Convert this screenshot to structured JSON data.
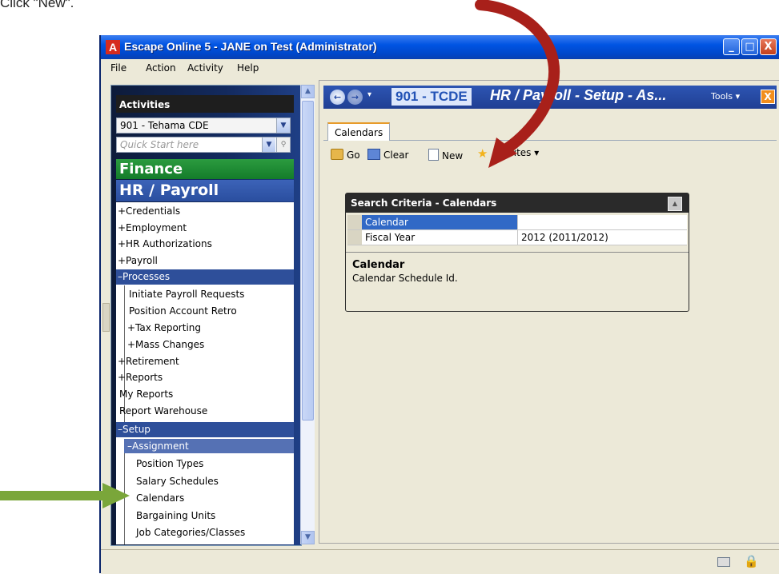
{
  "caption": "Click \"New\".",
  "window": {
    "title": "Escape Online 5 - JANE on Test (Administrator)",
    "app_icon_letter": "A",
    "minimize": "_",
    "maximize": "□",
    "close": "X"
  },
  "menu": [
    {
      "first": "F",
      "rest": "ile"
    },
    {
      "first": "",
      "u": "c",
      "pre": "A",
      "post": "tion"
    },
    {
      "first": "A",
      "rest": "ctivity"
    },
    {
      "first": "H",
      "rest": "elp"
    }
  ],
  "menu_labels": {
    "file": "File",
    "action": "Action",
    "activity": "Activity",
    "help": "Help"
  },
  "sidebar": {
    "header": "Activities",
    "org_select": "901 - Tehama CDE",
    "quick_start_placeholder": "Quick Start here",
    "finance": "Finance",
    "hr_payroll": "HR / Payroll",
    "items": [
      "+Credentials",
      "+Employment",
      "+HR Authorizations",
      "+Payroll",
      "–Processes",
      "Initiate Payroll Requests",
      "Position Account Retro",
      "+Tax Reporting",
      "+Mass Changes",
      "+Retirement",
      "+Reports",
      "My Reports",
      "Report Warehouse",
      "–Setup",
      "–Assignment",
      "Position Types",
      "Salary Schedules",
      "Calendars",
      "Bargaining Units",
      "Job Categories/Classes"
    ]
  },
  "main": {
    "org_code": "901 - TCDE",
    "title": "HR / Payroll - Setup - As...",
    "tools": "Tools ▾",
    "close": "X",
    "tab": "Calendars",
    "toolbar": {
      "go": "Go",
      "clear": "Clear",
      "new": "New",
      "favorites": "★",
      "favorites_label": "orites ▾"
    },
    "search": {
      "header": "Search Criteria - Calendars",
      "rows": [
        {
          "label": "Calendar",
          "value": ""
        },
        {
          "label": "Fiscal Year",
          "value": "2012 (2011/2012)"
        }
      ],
      "desc_title": "Calendar",
      "desc_text": "Calendar Schedule Id."
    }
  },
  "colors": {
    "title_bar": "#0054e3",
    "finance_green": "#147c2a",
    "hr_blue": "#2a4e9f",
    "selected_nav": "#2e4f9a",
    "annotation_green": "#7aa63a",
    "annotation_red": "#a8201a"
  }
}
